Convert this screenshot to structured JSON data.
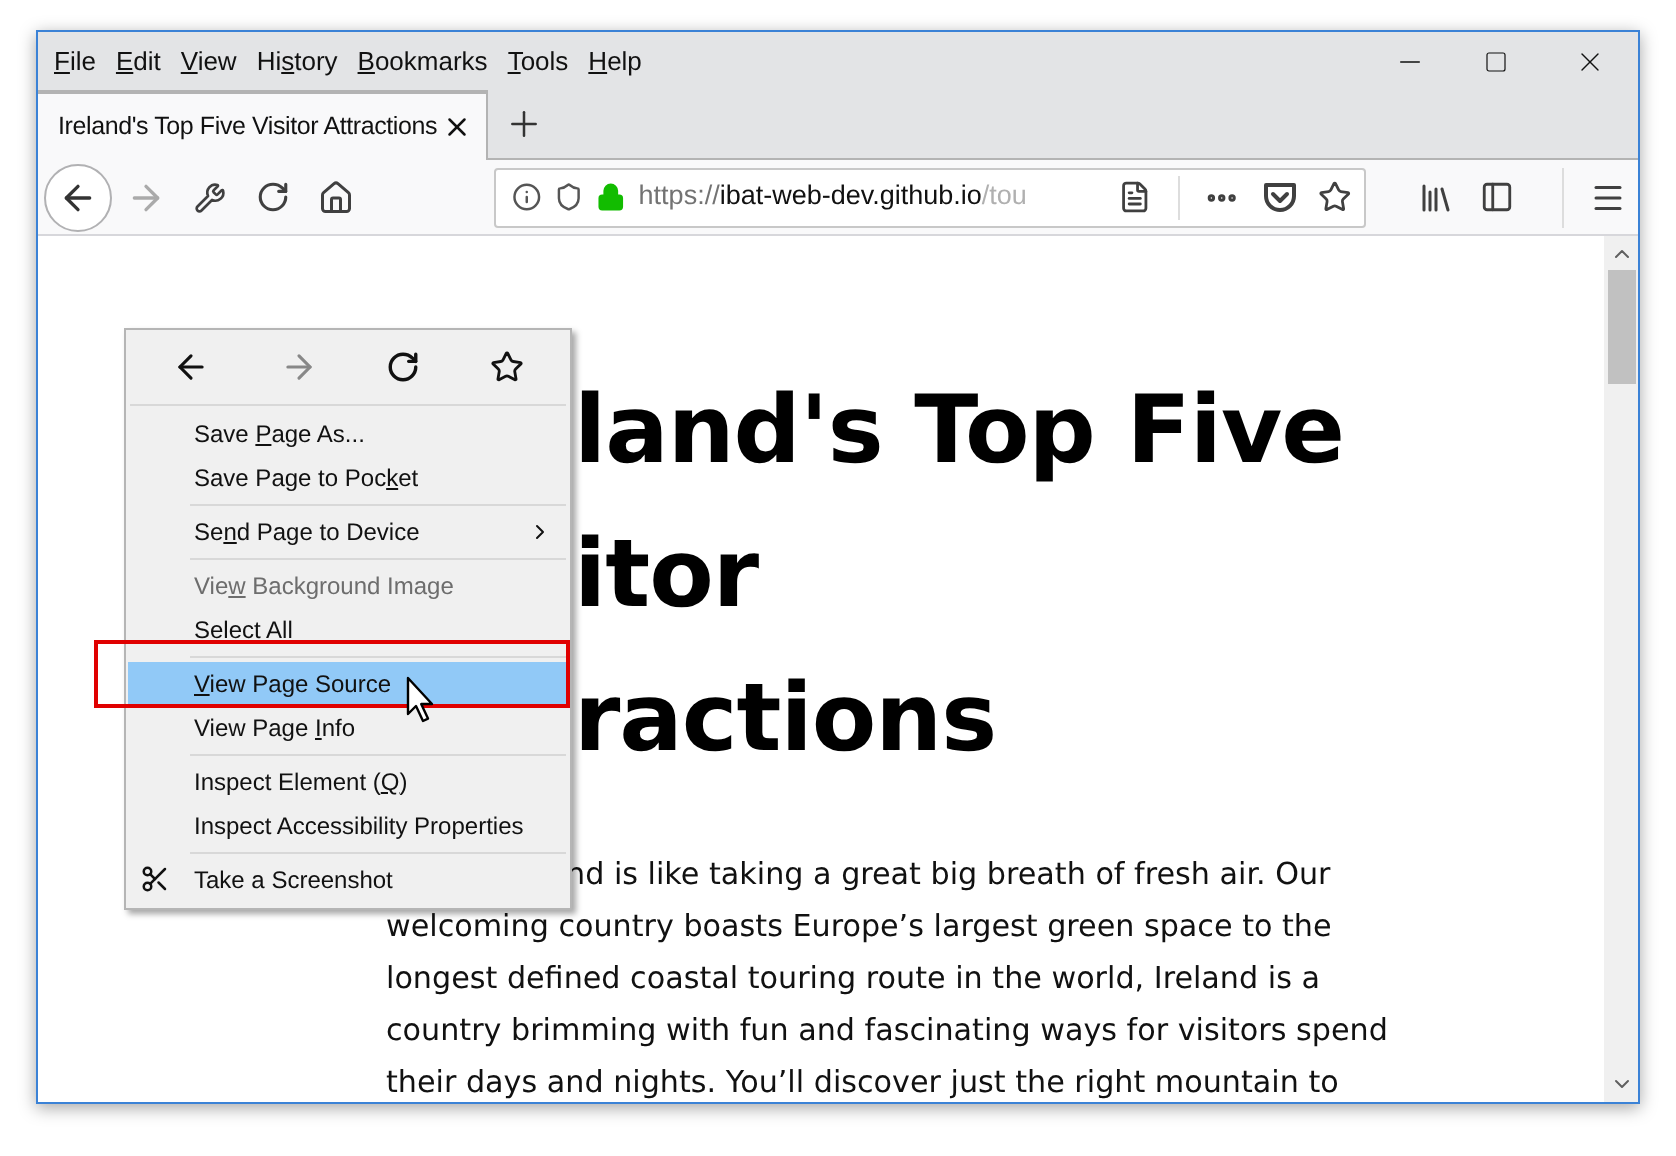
{
  "menubar": [
    {
      "key": "F",
      "post": "ile"
    },
    {
      "key": "E",
      "post": "dit"
    },
    {
      "key": "V",
      "post": "iew"
    },
    {
      "pre": "Hi",
      "key": "s",
      "post": "tory"
    },
    {
      "key": "B",
      "post": "ookmarks"
    },
    {
      "key": "T",
      "post": "ools"
    },
    {
      "key": "H",
      "post": "elp"
    }
  ],
  "tabs": [
    {
      "title": "Ireland's Top Five Visitor Attractions",
      "selected": true
    }
  ],
  "toolbar": {
    "url_scheme": "https://",
    "url_host": "ibat-web-dev.github.io",
    "url_path": "/tou",
    "forward_disabled": true
  },
  "page": {
    "heading_lines": [
      "land's Top Five",
      "itor",
      "ractions"
    ],
    "paragraph_lines": [
      "nd is like taking a great big breath of fresh air. Our",
      "welcoming country boasts Europe’s largest green space to the",
      "longest defined coastal touring route in the world, Ireland is a",
      "country brimming with fun and fascinating ways for visitors spend",
      "their days and nights. You’ll discover just the right mountain to"
    ]
  },
  "context_menu": {
    "items": [
      {
        "kind": "item",
        "pre": "Save ",
        "key": "P",
        "post": "age As...",
        "disabled": false,
        "selected": false,
        "submenu": false
      },
      {
        "kind": "item",
        "pre": "Save Page to Poc",
        "key": "k",
        "post": "et",
        "disabled": false,
        "selected": false,
        "submenu": false
      },
      {
        "kind": "separator"
      },
      {
        "kind": "item",
        "pre": "Se",
        "key": "n",
        "post": "d Page to Device",
        "disabled": false,
        "selected": false,
        "submenu": true
      },
      {
        "kind": "separator"
      },
      {
        "kind": "item",
        "pre": "Vie",
        "key": "w",
        "post": " Background Image",
        "disabled": true,
        "selected": false,
        "submenu": false
      },
      {
        "kind": "item",
        "pre": "Select All",
        "disabled": false,
        "selected": false,
        "submenu": false
      },
      {
        "kind": "separator"
      },
      {
        "kind": "item",
        "key": "V",
        "post": "iew Page Source",
        "disabled": false,
        "selected": true,
        "submenu": false
      },
      {
        "kind": "item",
        "pre": "View Page ",
        "key": "I",
        "post": "nfo",
        "disabled": false,
        "selected": false,
        "submenu": false
      },
      {
        "kind": "separator"
      },
      {
        "kind": "item",
        "pre": "Inspect Element (",
        "key": "Q",
        "post": ")",
        "disabled": false,
        "selected": false,
        "submenu": false
      },
      {
        "kind": "item",
        "pre": "Inspect Accessibility Properties",
        "disabled": false,
        "selected": false,
        "submenu": false
      },
      {
        "kind": "separator"
      },
      {
        "kind": "screenshot",
        "pre": "Take a Screenshot",
        "disabled": false,
        "selected": false,
        "submenu": false
      }
    ]
  }
}
